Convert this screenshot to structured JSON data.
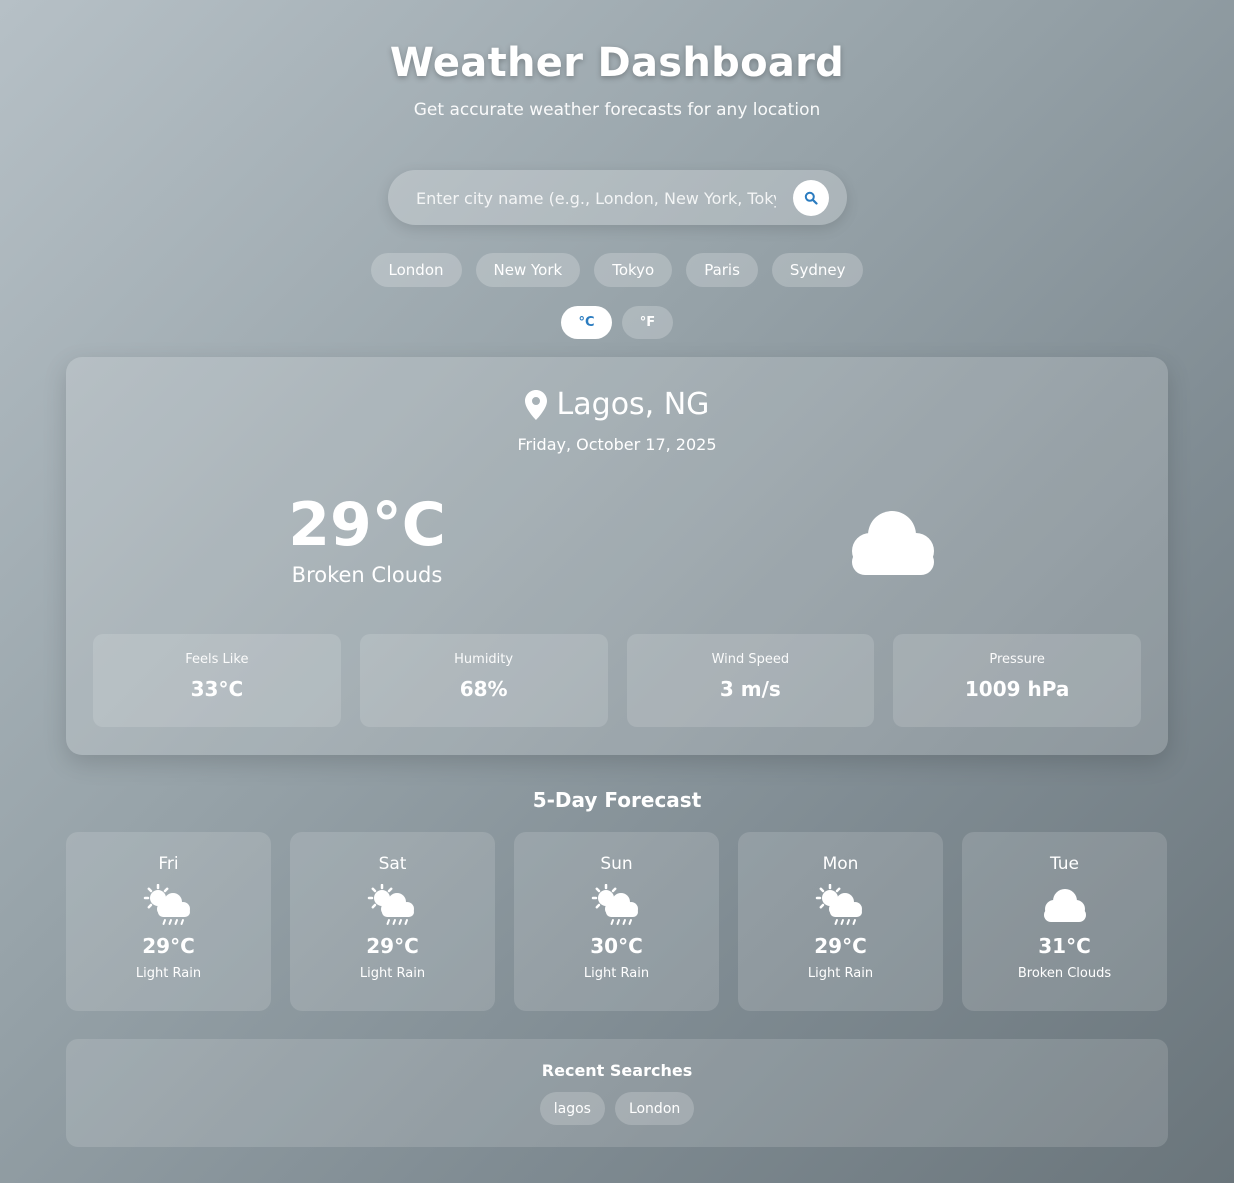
{
  "header": {
    "title": "Weather Dashboard",
    "subtitle": "Get accurate weather forecasts for any location"
  },
  "search": {
    "placeholder": "Enter city name (e.g., London, New York, Tokyo)",
    "value": "",
    "button_icon": "search-icon"
  },
  "quick_cities": [
    "London",
    "New York",
    "Tokyo",
    "Paris",
    "Sydney"
  ],
  "units": {
    "celsius": "°C",
    "fahrenheit": "°F",
    "selected": "celsius"
  },
  "current": {
    "location_icon": "map-pin-icon",
    "location": "Lagos, NG",
    "date": "Friday, October 17, 2025",
    "temperature": "29°C",
    "condition": "Broken Clouds",
    "icon": "cloud-icon",
    "details": [
      {
        "label": "Feels Like",
        "value": "33°C"
      },
      {
        "label": "Humidity",
        "value": "68%"
      },
      {
        "label": "Wind Speed",
        "value": "3 m/s"
      },
      {
        "label": "Pressure",
        "value": "1009 hPa"
      }
    ]
  },
  "forecast": {
    "title": "5-Day Forecast",
    "days": [
      {
        "day": "Fri",
        "temp": "29°C",
        "condition": "Light Rain",
        "icon": "sun-rain-cloud-icon"
      },
      {
        "day": "Sat",
        "temp": "29°C",
        "condition": "Light Rain",
        "icon": "sun-rain-cloud-icon"
      },
      {
        "day": "Sun",
        "temp": "30°C",
        "condition": "Light Rain",
        "icon": "sun-rain-cloud-icon"
      },
      {
        "day": "Mon",
        "temp": "29°C",
        "condition": "Light Rain",
        "icon": "sun-rain-cloud-icon"
      },
      {
        "day": "Tue",
        "temp": "31°C",
        "condition": "Broken Clouds",
        "icon": "cloud-icon"
      }
    ]
  },
  "recent": {
    "title": "Recent Searches",
    "items": [
      "lagos",
      "London"
    ]
  },
  "colors": {
    "accent": "#2b7cc0",
    "card_text": "#ffffff"
  }
}
